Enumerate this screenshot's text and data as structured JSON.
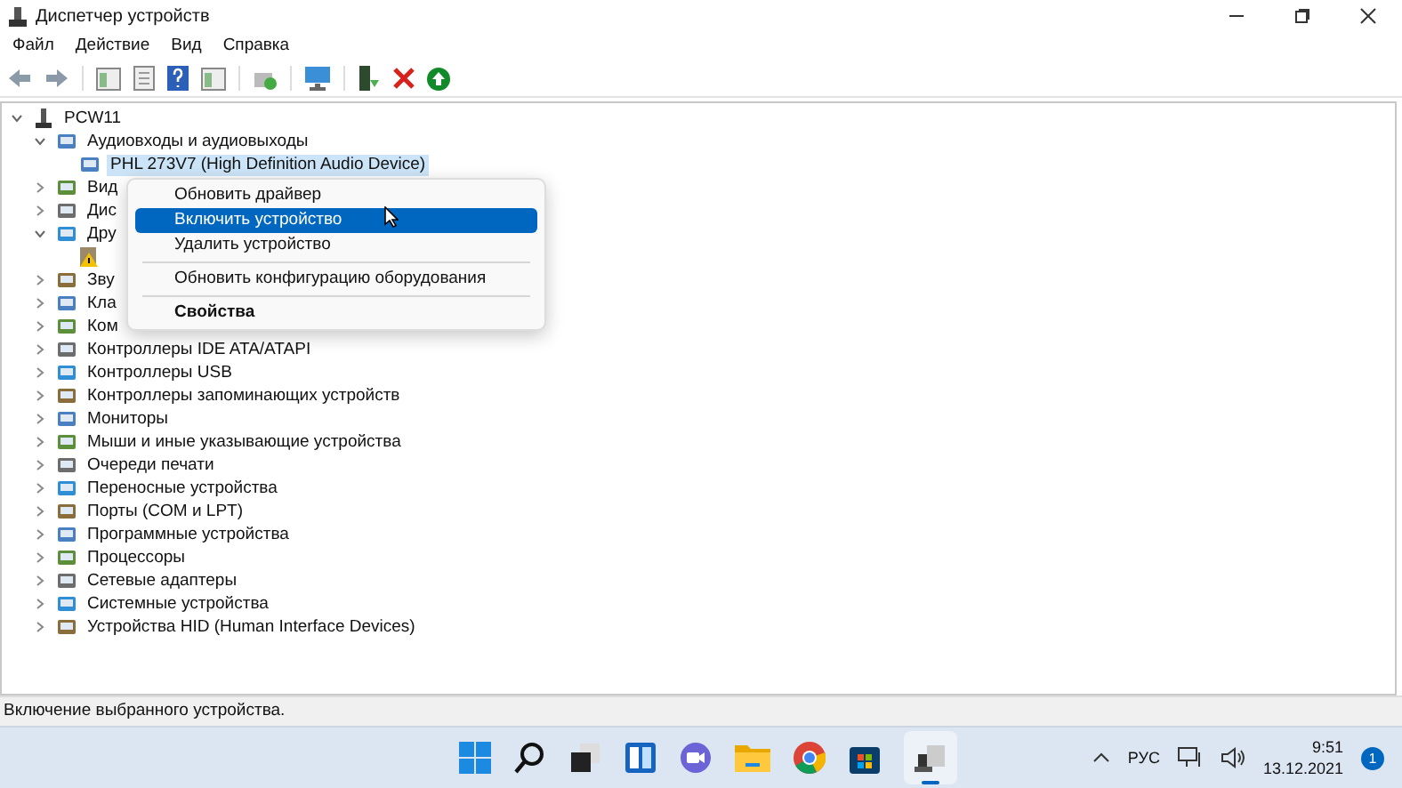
{
  "window": {
    "title": "Диспетчер устройств"
  },
  "menu_bar": [
    "Файл",
    "Действие",
    "Вид",
    "Справка"
  ],
  "tree": [
    {
      "label": "PCW11",
      "expanded": true,
      "selected": false,
      "children": [
        {
          "label": "Аудиовходы и аудиовыходы",
          "expanded": true,
          "selected": false,
          "children": [
            {
              "label": "PHL 273V7 (High Definition Audio Device)",
              "selected": true
            }
          ]
        },
        {
          "label": "Вид",
          "expanded": false,
          "selected": false
        },
        {
          "label": "Дис",
          "expanded": false,
          "selected": false
        },
        {
          "label": "Дру",
          "expanded": true,
          "selected": false,
          "children": [
            {
              "kind": "warning-device",
              "selected": false
            }
          ]
        },
        {
          "label": "Зву",
          "expanded": false,
          "selected": false
        },
        {
          "label": "Кла",
          "expanded": false,
          "selected": false
        },
        {
          "label": "Ком",
          "expanded": false,
          "selected": false
        },
        {
          "label": "Контроллеры IDE ATA/ATAPI",
          "expanded": false,
          "selected": false
        },
        {
          "label": "Контроллеры USB",
          "expanded": false,
          "selected": false
        },
        {
          "label": "Контроллеры запоминающих устройств",
          "expanded": false,
          "selected": false
        },
        {
          "label": "Мониторы",
          "expanded": false,
          "selected": false
        },
        {
          "label": "Мыши и иные указывающие устройства",
          "expanded": false,
          "selected": false
        },
        {
          "label": "Очереди печати",
          "expanded": false,
          "selected": false
        },
        {
          "label": "Переносные устройства",
          "expanded": false,
          "selected": false
        },
        {
          "label": "Порты (COM и LPT)",
          "expanded": false,
          "selected": false
        },
        {
          "label": "Программные устройства",
          "expanded": false,
          "selected": false
        },
        {
          "label": "Процессоры",
          "expanded": false,
          "selected": false
        },
        {
          "label": "Сетевые адаптеры",
          "expanded": false,
          "selected": false
        },
        {
          "label": "Системные устройства",
          "expanded": false,
          "selected": false
        },
        {
          "label": "Устройства HID (Human Interface Devices)",
          "expanded": false,
          "selected": false
        }
      ]
    }
  ],
  "context_menu": [
    {
      "kind": "item",
      "label": "Обновить драйвер",
      "selected": false
    },
    {
      "kind": "item",
      "label": "Включить устройство",
      "selected": true
    },
    {
      "kind": "item",
      "label": "Удалить устройство",
      "selected": false
    },
    {
      "kind": "separator"
    },
    {
      "kind": "item",
      "label": "Обновить конфигурацию оборудования",
      "selected": false
    },
    {
      "kind": "separator"
    },
    {
      "kind": "default",
      "label": "Свойства",
      "selected": false
    }
  ],
  "status_bar": "Включение выбранного устройства.",
  "taskbar": {
    "language": "РУС",
    "time": "9:51",
    "date": "13.12.2021",
    "notifications": "1"
  }
}
